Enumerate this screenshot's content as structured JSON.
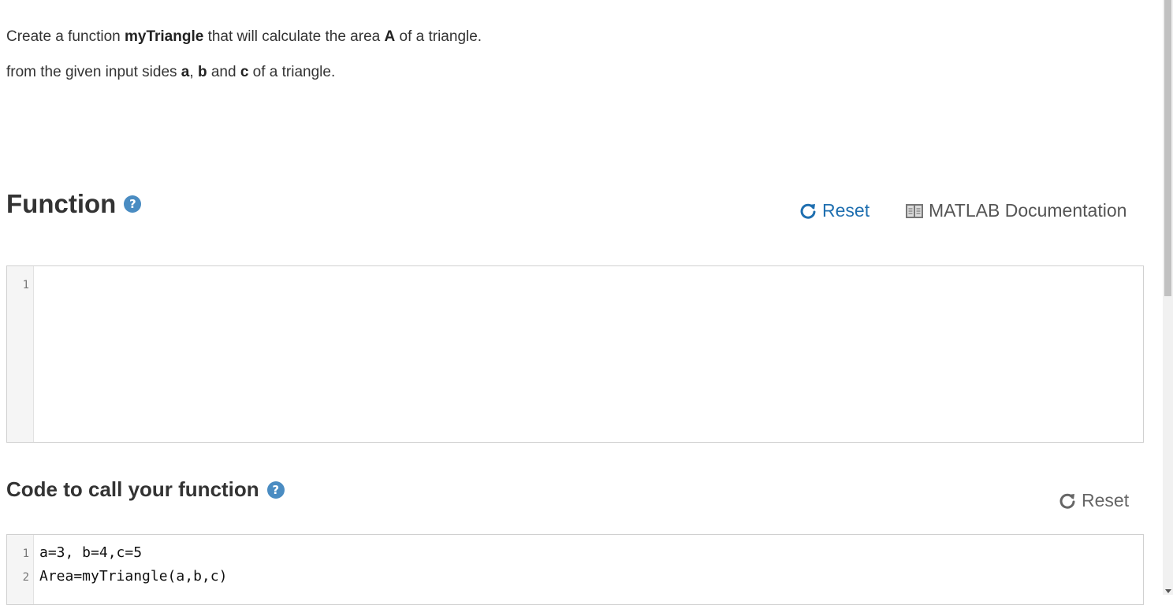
{
  "description": {
    "line1": {
      "t1": "Create a function ",
      "fn_name": "myTriangle",
      "t2": " that will calculate the area ",
      "area_var": "A",
      "t3": " of a triangle."
    },
    "line2": {
      "t1": "from the given input sides ",
      "a": "a",
      "sep1": ", ",
      "b": "b",
      "sep2": " and ",
      "c": "c",
      "t2": " of a triangle."
    }
  },
  "function_section": {
    "title": "Function",
    "help_glyph": "?",
    "reset_label": "Reset",
    "docs_label": "MATLAB Documentation",
    "editor": {
      "line_numbers": [
        "1"
      ],
      "lines": [
        ""
      ]
    }
  },
  "call_section": {
    "title": "Code to call your function",
    "help_glyph": "?",
    "reset_label": "Reset",
    "editor": {
      "line_numbers": [
        "1",
        "2"
      ],
      "lines": [
        "a=3, b=4,c=5",
        "Area=myTriangle(a,b,c)"
      ]
    }
  },
  "colors": {
    "help_icon": "#4a8cc2",
    "link_blue": "#1f6fb0",
    "gutter_bg": "#f5f5f5"
  }
}
